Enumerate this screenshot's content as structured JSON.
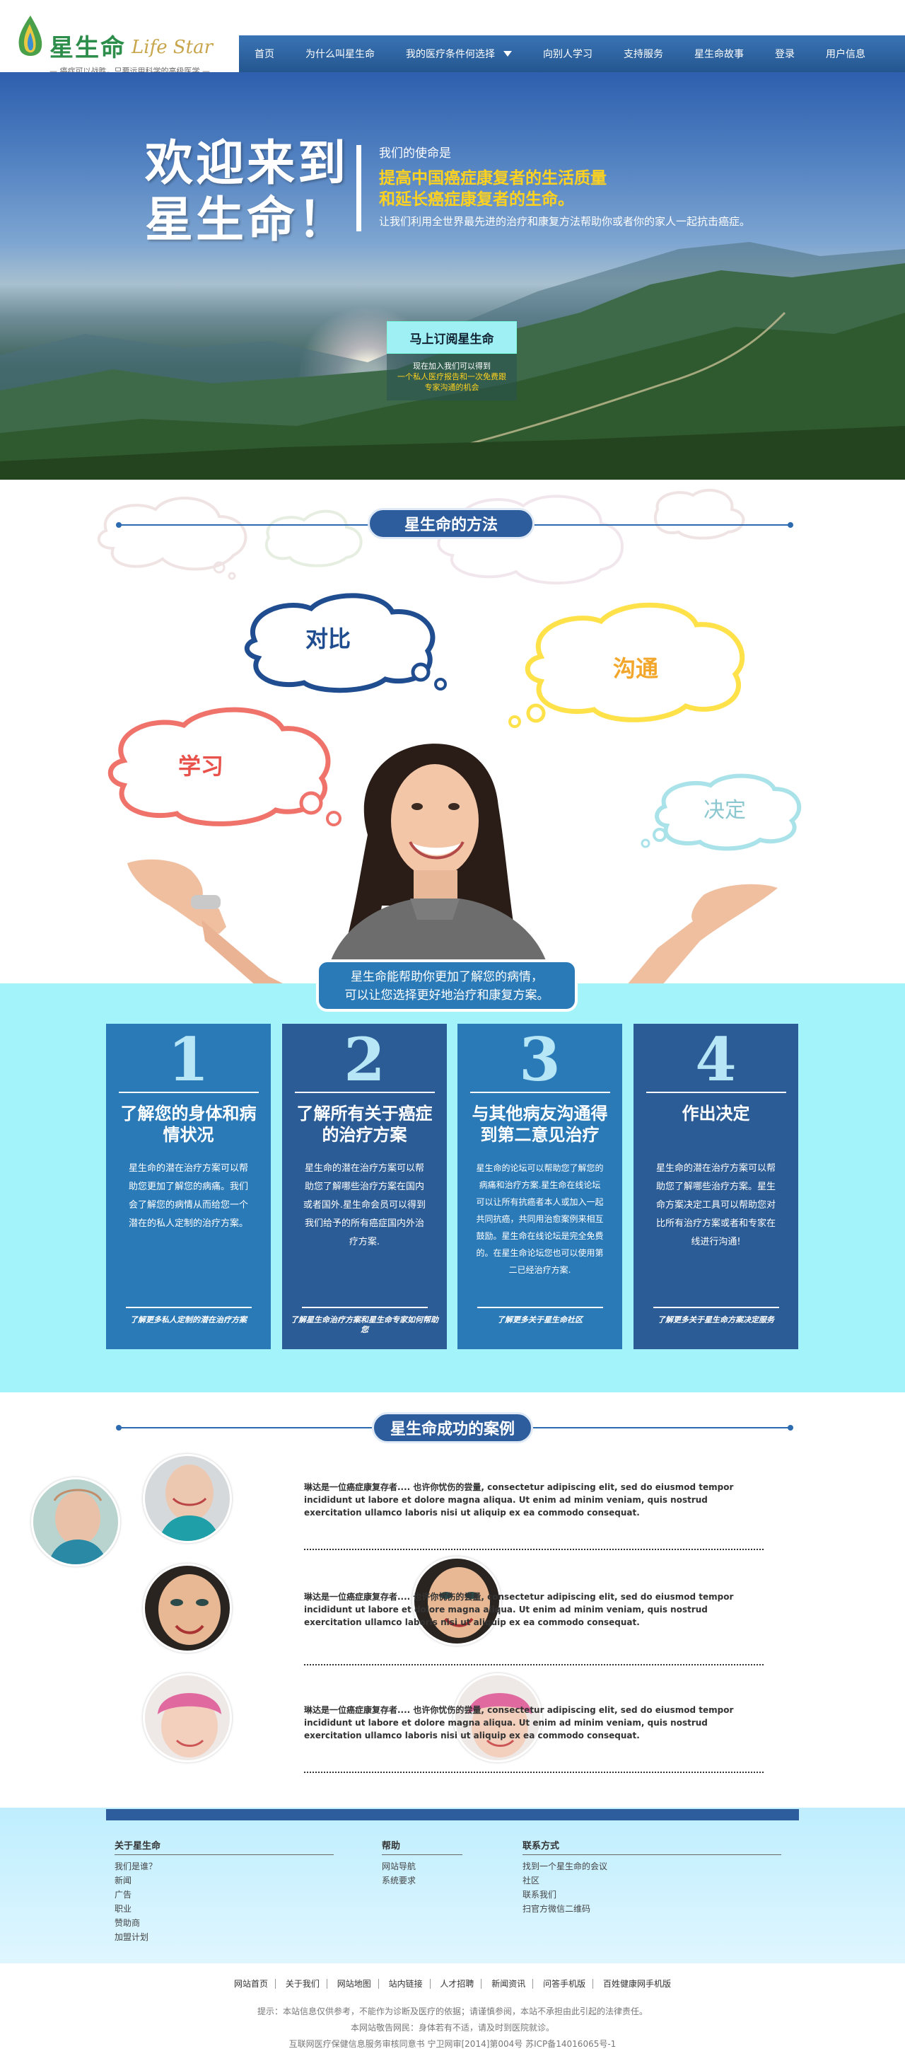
{
  "logo": {
    "cn": "星生命",
    "en": "Life Star",
    "slogan": "— 癌症可以战胜，只要运用科学的高级医学 —"
  },
  "nav": {
    "items": [
      "首页",
      "为什么叫星生命",
      "我的医疗条件何选择",
      "向别人学习",
      "支持服务",
      "星生命故事",
      "登录",
      "用户信息"
    ]
  },
  "hero": {
    "title_l1": "欢迎来到",
    "title_l2": "星生命！",
    "mission_label": "我们的使命是",
    "headline_l1": "提高中国癌症康复者的生活质量",
    "headline_l2": "和延长癌症康复者的生命。",
    "subline": "让我们利用全世界最先进的治疗和康复方法帮助你或者你的家人一起抗击癌症。",
    "subscribe_button": "马上订阅星生命",
    "panel_l1": "现在加入我们可以得到",
    "panel_l2": "一个私人医疗报告和一次免费跟",
    "panel_l3": "专家沟通的机会"
  },
  "method": {
    "title": "星生命的方法",
    "bubbles": {
      "compare": "对比",
      "communicate": "沟通",
      "learn": "学习",
      "decide": "决定"
    },
    "caption_l1": "星生命能帮助你更加了解您的病情，",
    "caption_l2": "可以让您选择更好地治疗和康复方案。"
  },
  "cards": [
    {
      "num": "1",
      "title": "了解您的身体和病情状况",
      "desc": "星生命的潜在治疗方案可以帮助您更加了解您的病痛。我们会了解您的病情从而给您一个潜在的私人定制的治疗方案。",
      "link": "了解更多私人定制的潜在治疗方案"
    },
    {
      "num": "2",
      "title": "了解所有关于癌症的治疗方案",
      "desc": "星生命的潜在治疗方案可以帮助您了解哪些治疗方案在国内或者国外.星生命会员可以得到我们给予的所有癌症国内外治疗方案.",
      "link": "了解星生命治疗方案和星生命专家如何帮助您"
    },
    {
      "num": "3",
      "title": "与其他病友沟通得到第二意见治疗",
      "desc": "星生命的论坛可以帮助您了解您的病痛和治疗方案.星生命在线论坛可以让所有抗癌者本人或加入一起共同抗癌，共同用治愈案例来相互鼓励。星生命在线论坛是完全免费的。在星生命论坛您也可以使用第二已经治疗方案.",
      "link": "了解更多关于星生命社区"
    },
    {
      "num": "4",
      "title": "作出决定",
      "desc": "星生命的潜在治疗方案可以帮助您了解哪些治疗方案。星生命方案决定工具可以帮助您对比所有治疗方案或者和专家在线进行沟通!",
      "link": "了解更多关于星生命方案决定服务"
    }
  ],
  "cases": {
    "title": "星生命成功的案例",
    "rows": [
      {
        "text": "琳达是一位癌症康复存者.... 也许你忧伤的尝量, consectetur adipiscing elit, sed do eiusmod tempor incididunt ut labore et dolore magna aliqua. Ut enim ad minim veniam, quis nostrud exercitation ullamco laboris nisi ut aliquip ex ea commodo consequat."
      },
      {
        "text": "琳达是一位癌症康复存者.... 也许你忧伤的尝量, consectetur adipiscing elit, sed do eiusmod tempor incididunt ut labore et dolore magna aliqua. Ut enim ad minim veniam, quis nostrud exercitation ullamco laboris nisi ut aliquip ex ea commodo consequat."
      },
      {
        "text": "琳达是一位癌症康复存者.... 也许你忧伤的尝量, consectetur adipiscing elit, sed do eiusmod tempor incididunt ut labore et dolore magna aliqua. Ut enim ad minim veniam, quis nostrud exercitation ullamco laboris nisi ut aliquip ex ea commodo consequat."
      }
    ]
  },
  "footer": {
    "col1": {
      "title": "关于星生命",
      "links": [
        "我们是谁？",
        "新闻",
        "广告",
        "职业",
        "赞助商",
        "加盟计划"
      ]
    },
    "col2": {
      "title": "帮助",
      "links": [
        "网站导航",
        "系统要求"
      ]
    },
    "col3": {
      "title": "联系方式",
      "links": [
        "找到一个星生命的会议",
        "社区",
        "联系我们",
        "扫官方微信二维码"
      ]
    },
    "bottom_links": [
      "网站首页",
      "关于我们",
      "网站地图",
      "站内链接",
      "人才招聘",
      "新闻资讯",
      "问答手机版",
      "百姓健康网手机版"
    ],
    "notice1": "提示：本站信息仅供参考，不能作为诊断及医疗的依据；请谨慎参阅，本站不承担由此引起的法律责任。",
    "notice2": "本网站敬告网民：身体若有不适，请及时到医院就诊。",
    "notice3": "互联网医疗保健信息服务审核同意书 宁卫网审[2014]第004号   苏ICP备14016065号-1"
  },
  "colors": {
    "nav": "#2d5d9c",
    "accent_yellow": "#ffd21f",
    "band": "#a3f3fb",
    "card_a": "#2a7ab8",
    "card_b": "#2c5c95"
  }
}
